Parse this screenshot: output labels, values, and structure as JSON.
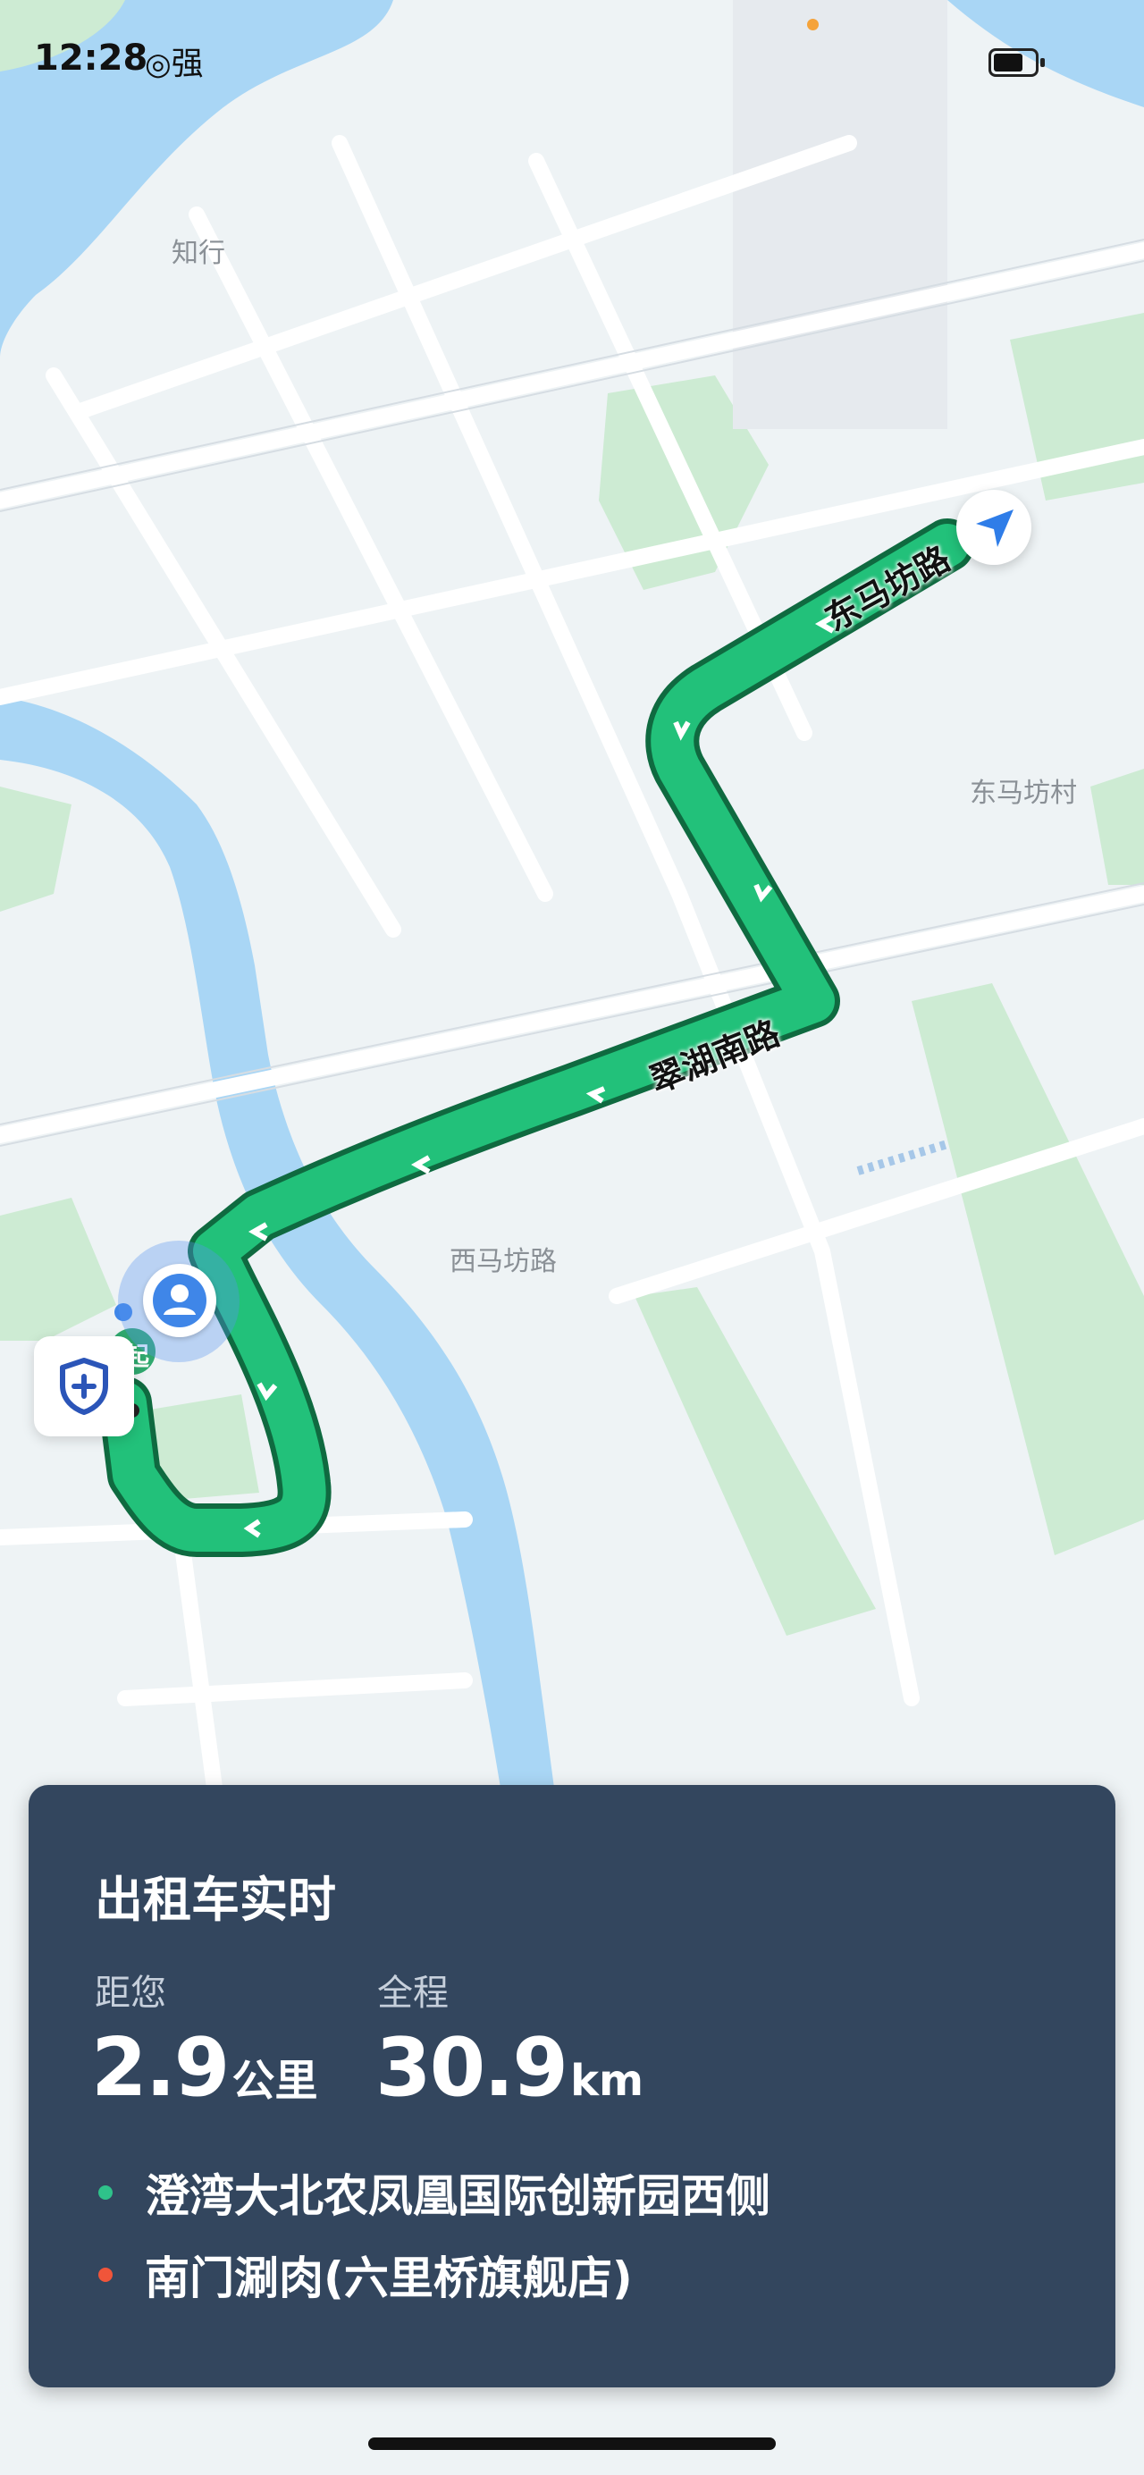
{
  "status_bar": {
    "time": "12:28",
    "signal": "强"
  },
  "map": {
    "place_labels": [
      "知行",
      "东马坊村",
      "西马坊路"
    ],
    "road_labels": [
      "东马坊路",
      "翠湖南路"
    ],
    "route_color": "#22c17a",
    "start_marker_text": "起"
  },
  "trip_card": {
    "title": "出租车实时",
    "distance_to_you": {
      "label": "距您",
      "value": "2.9",
      "unit": "公里"
    },
    "total_distance": {
      "label": "全程",
      "value": "30.9",
      "unit": "km"
    },
    "origin": {
      "text": "澄湾大北农凤凰国际创新园西侧",
      "color": "#2fc28a"
    },
    "destination": {
      "text": "南门涮肉(六里桥旗舰店)",
      "color": "#f0553a"
    }
  },
  "colors": {
    "card_bg": "#33465e",
    "water": "#a9d6f5",
    "green_area": "#cdebd3"
  },
  "icons": [
    "shield-plus-icon",
    "navigation-arrow-icon",
    "user-location-icon",
    "battery-icon"
  ]
}
